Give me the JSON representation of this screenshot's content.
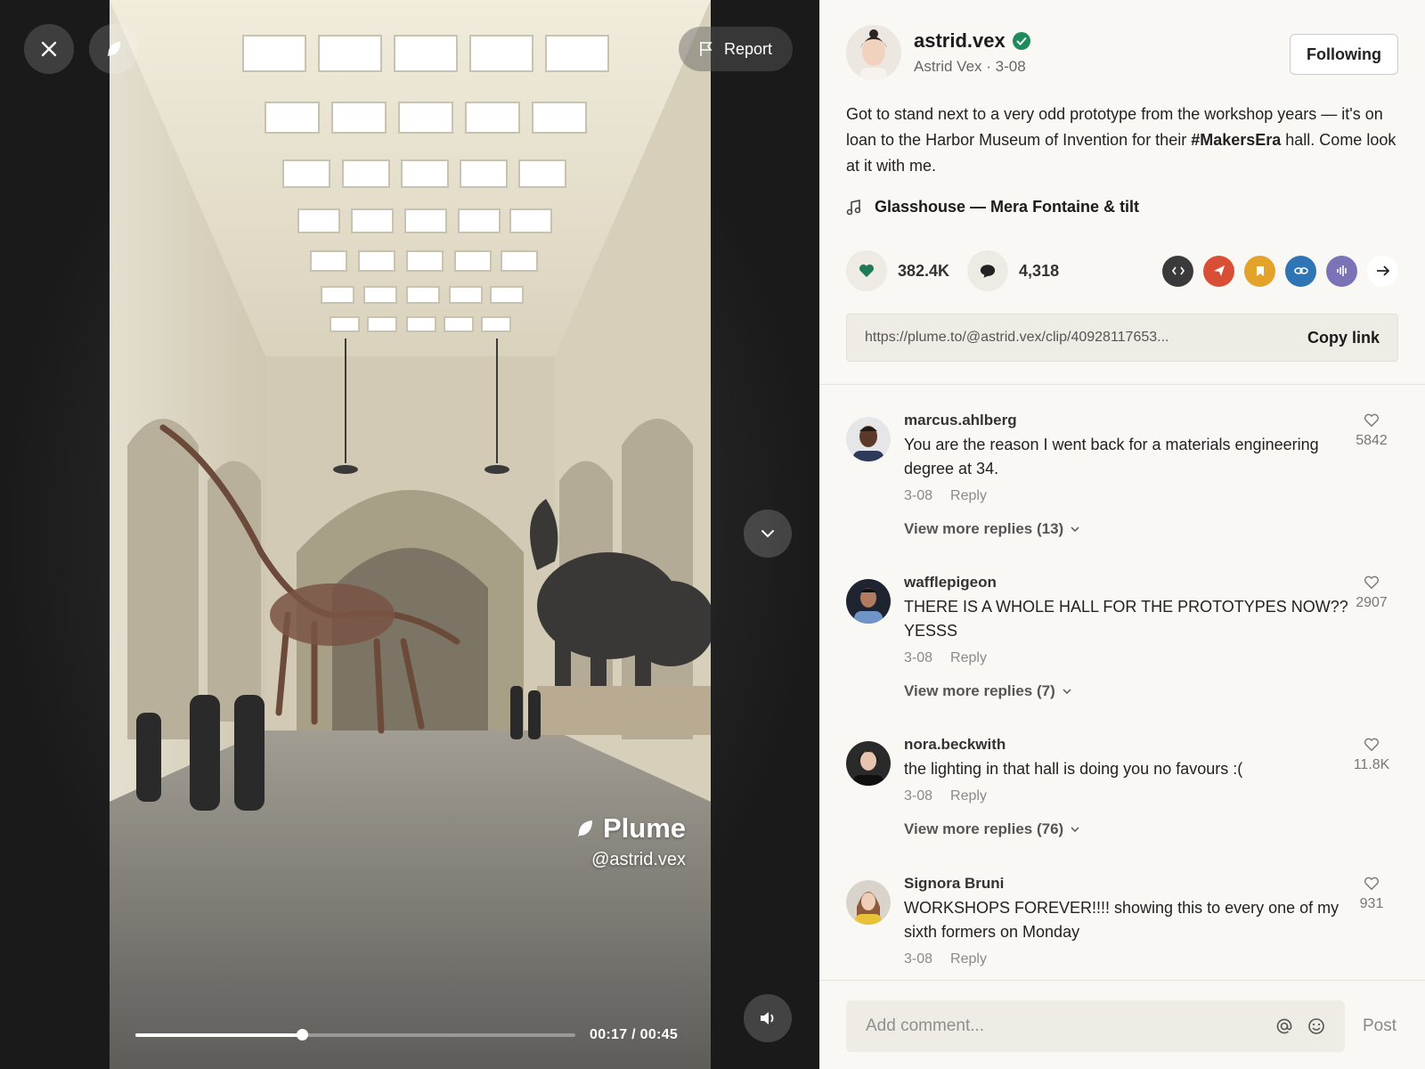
{
  "player": {
    "close_icon": "close-icon",
    "brand_icon": "feather-icon",
    "report_label": "Report",
    "watermark_brand": "Plume",
    "watermark_handle": "@astrid.vex",
    "time_display": "00:17 / 00:45",
    "progress_fraction": 0.378
  },
  "author": {
    "handle": "astrid.vex",
    "display_name": "Astrid Vex",
    "date": "3-08",
    "follow_label": "Following"
  },
  "post": {
    "caption_part1": "Got to stand next to a very odd prototype from the workshop years — it's on loan to the Harbor Museum of Invention for their ",
    "hashtag": "#MakersEra",
    "caption_part2": " hall. Come look at it with me.",
    "music": "Glasshouse — Mera Fontaine & tilt",
    "likes": "382.4K",
    "comments_count": "4,318",
    "share_colors": {
      "embed": "#3a3a3a",
      "send": "#d94f35",
      "bookmark": "#e3a32b",
      "link": "#2f74b5",
      "audio": "#7a73b8"
    },
    "link_url": "https://plume.to/@astrid.vex/clip/40928117653...",
    "copy_label": "Copy link"
  },
  "comments": [
    {
      "user": "marcus.ahlberg",
      "text": "You are the reason I went back for a materials engineering degree at 34.",
      "date": "3-08",
      "reply": "Reply",
      "likes": "5842",
      "more": "View more replies (13)"
    },
    {
      "user": "wafflepigeon",
      "text": "THERE IS A WHOLE HALL FOR THE PROTOTYPES NOW?? YESSS",
      "date": "3-08",
      "reply": "Reply",
      "likes": "2907",
      "more": "View more replies (7)"
    },
    {
      "user": "nora.beckwith",
      "text": "the lighting in that hall is doing you no favours :(",
      "date": "3-08",
      "reply": "Reply",
      "likes": "11.8K",
      "more": "View more replies (76)"
    },
    {
      "user": "Signora Bruni",
      "text": "WORKSHOPS FOREVER!!!! showing this to every one of my sixth formers on Monday",
      "date": "3-08",
      "reply": "Reply",
      "likes": "931",
      "more": ""
    }
  ],
  "composer": {
    "placeholder": "Add comment...",
    "post_label": "Post"
  }
}
